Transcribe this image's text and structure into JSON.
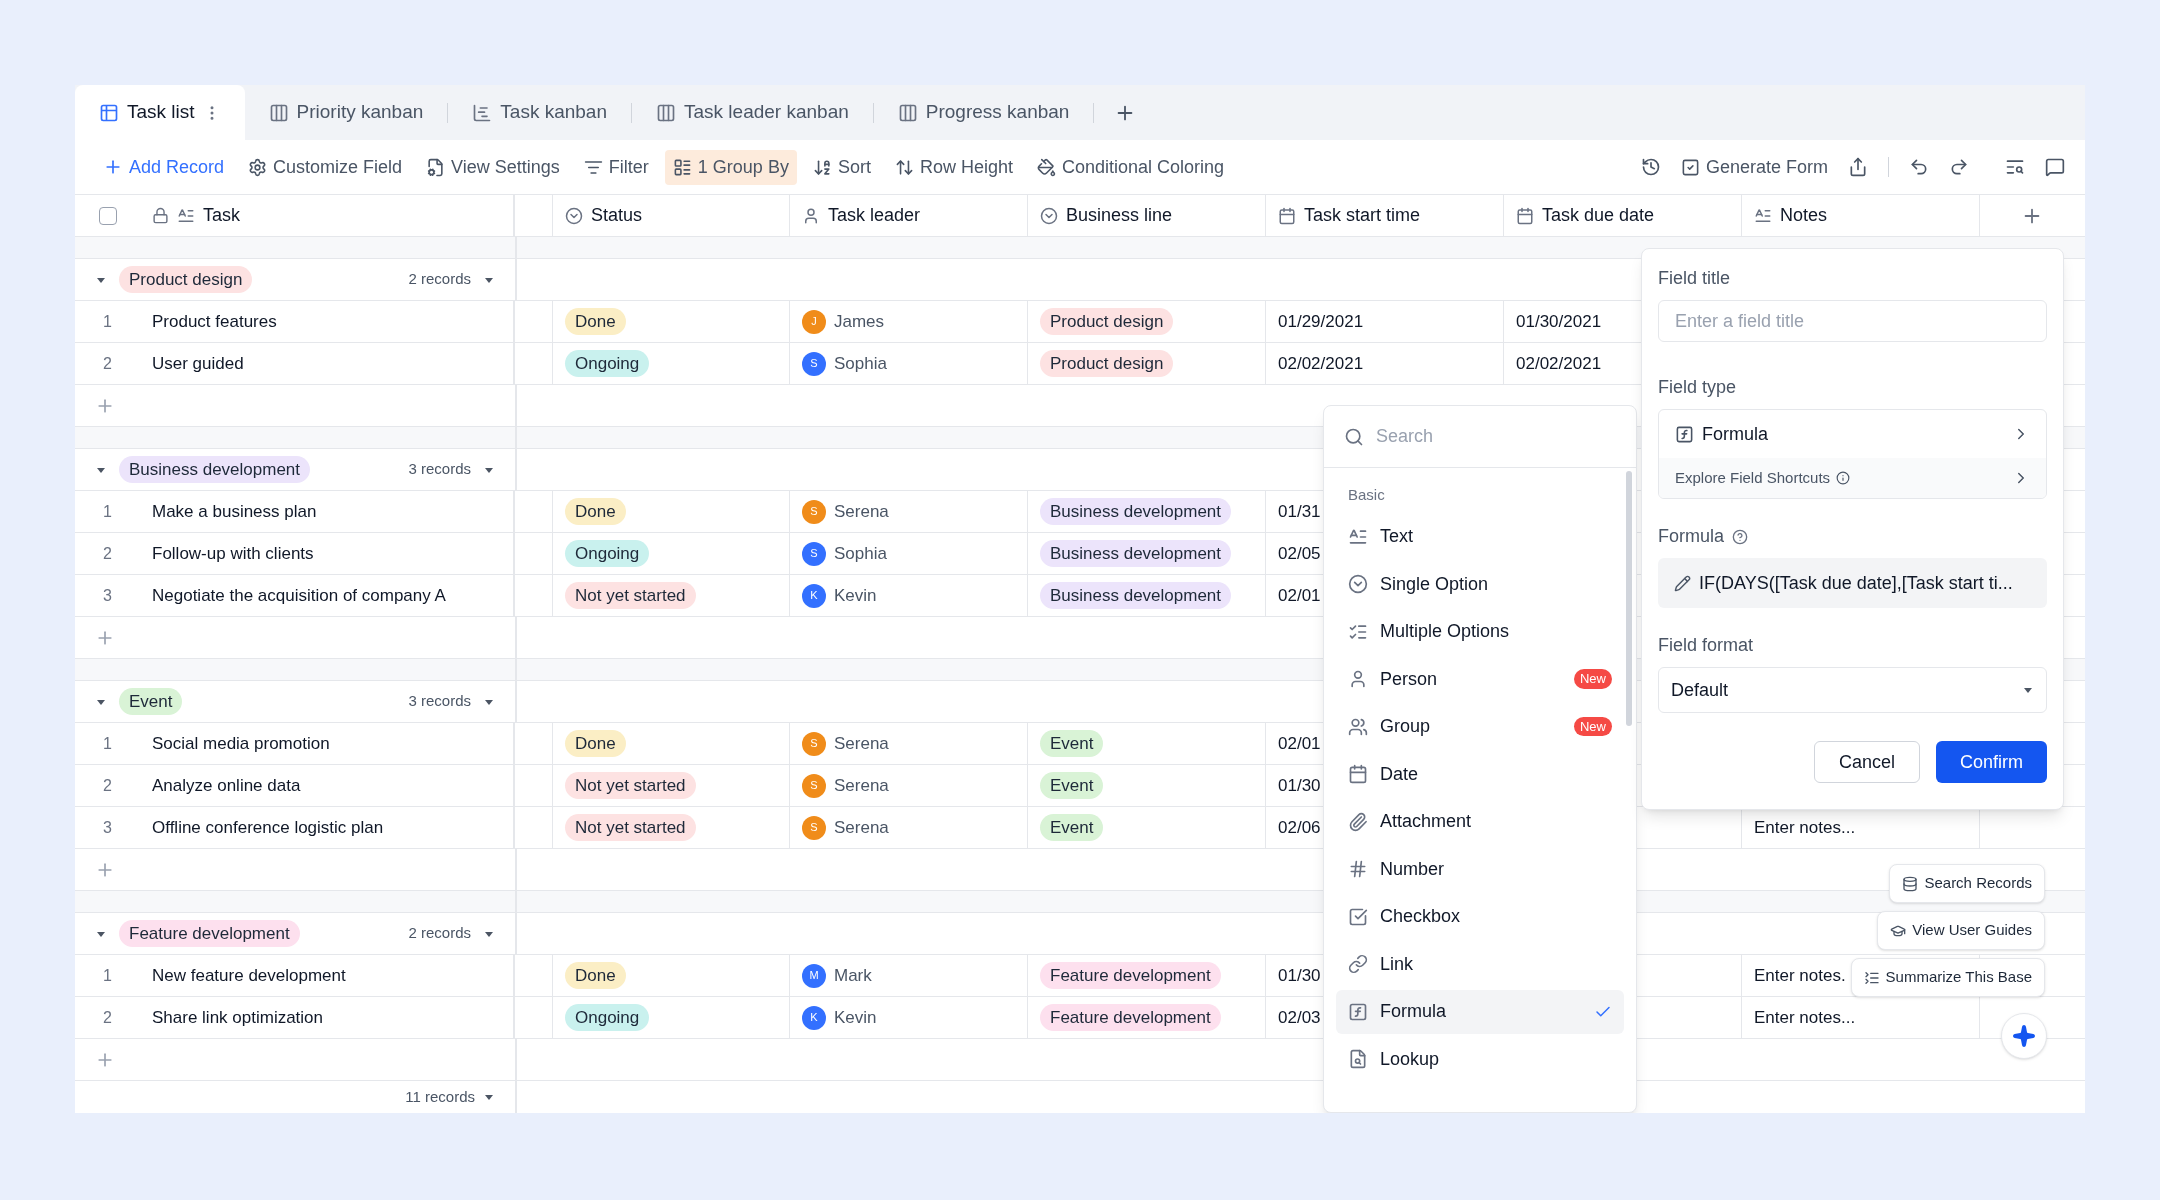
{
  "tabs": [
    {
      "label": "Task list",
      "kind": "grid",
      "selected": true
    },
    {
      "label": "Priority kanban",
      "kind": "kanban",
      "selected": false
    },
    {
      "label": "Task kanban",
      "kind": "gantt",
      "selected": false
    },
    {
      "label": "Task leader kanban",
      "kind": "kanban",
      "selected": false
    },
    {
      "label": "Progress kanban",
      "kind": "kanban",
      "selected": false
    }
  ],
  "toolbar": {
    "left": [
      {
        "label": "Add Record",
        "kind": "add",
        "active": false
      },
      {
        "label": "Customize Field",
        "kind": "customize",
        "active": false
      },
      {
        "label": "View Settings",
        "kind": "view",
        "active": false
      },
      {
        "label": "Filter",
        "kind": "filter",
        "active": false
      },
      {
        "label": "1 Group By",
        "kind": "group",
        "active": true
      },
      {
        "label": "Sort",
        "kind": "sort",
        "active": false
      },
      {
        "label": "Row Height",
        "kind": "row_height",
        "active": false
      },
      {
        "label": "Conditional Coloring",
        "kind": "coloring",
        "active": false
      }
    ],
    "generate_form": "Generate Form"
  },
  "columns": [
    {
      "label": "Task",
      "kind": "text"
    },
    {
      "label": "Status",
      "kind": "option"
    },
    {
      "label": "Task leader",
      "kind": "person"
    },
    {
      "label": "Business line",
      "kind": "option"
    },
    {
      "label": "Task start time",
      "kind": "date"
    },
    {
      "label": "Task due date",
      "kind": "date"
    },
    {
      "label": "Notes",
      "kind": "text"
    }
  ],
  "select_all": {
    "checked": false
  },
  "groups": [
    {
      "name": "Product design",
      "color": "#fde2e2",
      "count": "2 records",
      "expanded": true,
      "records": [
        {
          "index": "1",
          "task": "Product features",
          "status": {
            "text": "Done",
            "color": "#fbeec5"
          },
          "leader": {
            "initial": "J",
            "name": "James",
            "color": "#f08c1a"
          },
          "business": {
            "text": "Product design",
            "color": "#fde2e2"
          },
          "start": "01/29/2021",
          "due": "01/30/2021"
        },
        {
          "index": "2",
          "task": "User guided",
          "status": {
            "text": "Ongoing",
            "color": "#c9f1ee"
          },
          "leader": {
            "initial": "S",
            "name": "Sophia",
            "color": "#3370ff"
          },
          "business": {
            "text": "Product design",
            "color": "#fde2e2"
          },
          "start": "02/02/2021",
          "due": "02/02/2021"
        }
      ]
    },
    {
      "name": "Business development",
      "color": "#ece4fb",
      "count": "3 records",
      "expanded": true,
      "records": [
        {
          "index": "1",
          "task": "Make a business plan",
          "status": {
            "text": "Done",
            "color": "#fbeec5"
          },
          "leader": {
            "initial": "S",
            "name": "Serena",
            "color": "#f08c1a"
          },
          "business": {
            "text": "Business development",
            "color": "#ece4fb"
          },
          "start": "01/31"
        },
        {
          "index": "2",
          "task": "Follow-up with clients",
          "status": {
            "text": "Ongoing",
            "color": "#c9f1ee"
          },
          "leader": {
            "initial": "S",
            "name": "Sophia",
            "color": "#3370ff"
          },
          "business": {
            "text": "Business development",
            "color": "#ece4fb"
          },
          "start": "02/05"
        },
        {
          "index": "3",
          "task": "Negotiate the acquisition of company A",
          "status": {
            "text": "Not yet started",
            "color": "#fde2e2"
          },
          "leader": {
            "initial": "K",
            "name": "Kevin",
            "color": "#3370ff"
          },
          "business": {
            "text": "Business development",
            "color": "#ece4fb"
          },
          "start": "02/01"
        }
      ]
    },
    {
      "name": "Event",
      "color": "#d9f3d6",
      "count": "3 records",
      "expanded": true,
      "records": [
        {
          "index": "1",
          "task": "Social media promotion",
          "status": {
            "text": "Done",
            "color": "#fbeec5"
          },
          "leader": {
            "initial": "S",
            "name": "Serena",
            "color": "#f08c1a"
          },
          "business": {
            "text": "Event",
            "color": "#d9f3d6"
          },
          "start": "02/01"
        },
        {
          "index": "2",
          "task": "Analyze online data",
          "status": {
            "text": "Not yet started",
            "color": "#fde2e2"
          },
          "leader": {
            "initial": "S",
            "name": "Serena",
            "color": "#f08c1a"
          },
          "business": {
            "text": "Event",
            "color": "#d9f3d6"
          },
          "start": "01/30"
        },
        {
          "index": "3",
          "task": "Offline conference logistic plan",
          "status": {
            "text": "Not yet started",
            "color": "#fde2e2"
          },
          "leader": {
            "initial": "S",
            "name": "Serena",
            "color": "#f08c1a"
          },
          "business": {
            "text": "Event",
            "color": "#d9f3d6"
          },
          "start": "02/06",
          "notes": "Enter notes..."
        }
      ]
    },
    {
      "name": "Feature development",
      "color": "#fde0ee",
      "count": "2 records",
      "expanded": true,
      "records": [
        {
          "index": "1",
          "task": "New feature development",
          "status": {
            "text": "Done",
            "color": "#fbeec5"
          },
          "leader": {
            "initial": "M",
            "name": "Mark",
            "color": "#3370ff"
          },
          "business": {
            "text": "Feature development",
            "color": "#fde0ee"
          },
          "start": "01/30",
          "notes": "Enter notes."
        },
        {
          "index": "2",
          "task": "Share link optimization",
          "status": {
            "text": "Ongoing",
            "color": "#c9f1ee"
          },
          "leader": {
            "initial": "K",
            "name": "Kevin",
            "color": "#3370ff"
          },
          "business": {
            "text": "Feature development",
            "color": "#fde0ee"
          },
          "start": "02/03",
          "notes": "Enter notes..."
        }
      ]
    }
  ],
  "footer": {
    "count": "11 records"
  },
  "type_menu": {
    "search_placeholder": "Search",
    "section": "Basic",
    "items": [
      {
        "label": "Text",
        "kind": "text",
        "selected": false
      },
      {
        "label": "Single Option",
        "kind": "single",
        "selected": false
      },
      {
        "label": "Multiple Options",
        "kind": "multiple",
        "selected": false
      },
      {
        "label": "Person",
        "kind": "person",
        "selected": false,
        "badge": "New"
      },
      {
        "label": "Group",
        "kind": "group",
        "selected": false,
        "badge": "New"
      },
      {
        "label": "Date",
        "kind": "date",
        "selected": false
      },
      {
        "label": "Attachment",
        "kind": "attachment",
        "selected": false
      },
      {
        "label": "Number",
        "kind": "number",
        "selected": false
      },
      {
        "label": "Checkbox",
        "kind": "checkbox",
        "selected": false
      },
      {
        "label": "Link",
        "kind": "link",
        "selected": false
      },
      {
        "label": "Formula",
        "kind": "formula",
        "selected": true
      },
      {
        "label": "Lookup",
        "kind": "lookup",
        "selected": false
      }
    ]
  },
  "field_panel": {
    "title_label": "Field title",
    "title_placeholder": "Enter a field title",
    "type_label": "Field type",
    "type_value": "Formula",
    "shortcuts": "Explore Field Shortcuts",
    "formula_label": "Formula",
    "formula_value": "IF(DAYS([Task due date],[Task start ti...",
    "format_label": "Field format",
    "format_value": "Default",
    "cancel": "Cancel",
    "confirm": "Confirm"
  },
  "floating_actions": [
    {
      "label": "Search Records",
      "kind": "search"
    },
    {
      "label": "View User Guides",
      "kind": "guides"
    },
    {
      "label": "Summarize This Base",
      "kind": "summarize"
    }
  ]
}
